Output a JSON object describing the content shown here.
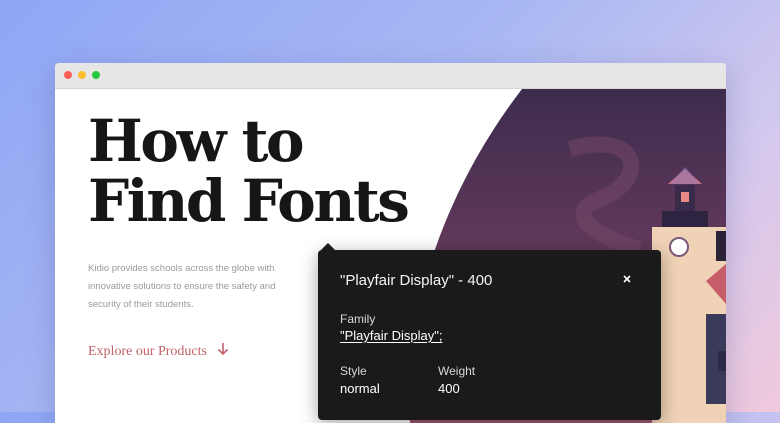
{
  "page": {
    "headline": [
      "How to",
      "Find Fonts"
    ],
    "description": [
      "Kidio provides schools across the globe with",
      "innovative solutions to ensure the safety and",
      "security of their students."
    ],
    "cta_label": "Explore our Products"
  },
  "inspector": {
    "title": "\"Playfair Display\" - 400",
    "family_label": "Family",
    "family_value": "\"Playfair Display\";",
    "style_label": "Style",
    "style_value": "normal",
    "weight_label": "Weight",
    "weight_value": "400"
  },
  "colors": {
    "accent": "#c0616b",
    "inspector_bg": "#1a1a1a",
    "headline": "#161616"
  },
  "icons": [
    "close-icon",
    "arrow-down-icon"
  ]
}
